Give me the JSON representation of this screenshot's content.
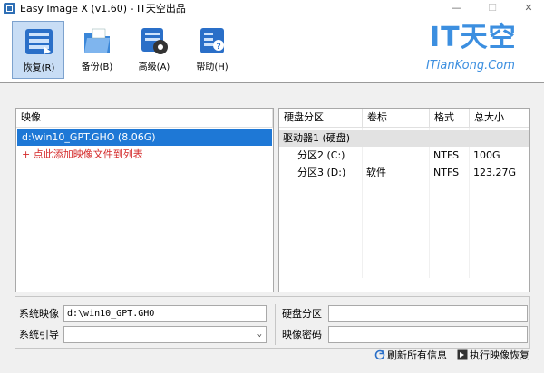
{
  "window": {
    "title": "Easy Image X (v1.60) - IT天空出品",
    "min_glyph": "—",
    "max_glyph": "☐",
    "close_glyph": "✕"
  },
  "toolbar": {
    "buttons": [
      {
        "label": "恢复(R)",
        "icon": "restore-icon",
        "active": true
      },
      {
        "label": "备份(B)",
        "icon": "backup-icon",
        "active": false
      },
      {
        "label": "高级(A)",
        "icon": "advanced-icon",
        "active": false
      },
      {
        "label": "帮助(H)",
        "icon": "help-icon",
        "active": false
      }
    ]
  },
  "brand": {
    "main": "IT天空",
    "sub": "ITianKong.Com",
    "color": "#3c8fe0"
  },
  "image_list": {
    "header": "映像",
    "items": [
      "d:\\win10_GPT.GHO (8.06G)"
    ],
    "add_hint": "+ 点此添加映像文件到列表"
  },
  "disk_table": {
    "columns": [
      "硬盘分区",
      "卷标",
      "格式",
      "总大小"
    ],
    "drive": "驱动器1 (硬盘)",
    "partitions": [
      {
        "name": "分区2 (C:)",
        "label": "",
        "format": "NTFS",
        "size": "100G"
      },
      {
        "name": "分区3 (D:)",
        "label": "软件",
        "format": "NTFS",
        "size": "123.27G"
      }
    ]
  },
  "form": {
    "system_image_label": "系统映像",
    "system_image_value": "d:\\win10_GPT.GHO",
    "system_boot_label": "系统引导",
    "system_boot_value": "",
    "disk_partition_label": "硬盘分区",
    "disk_partition_value": "",
    "image_password_label": "映像密码",
    "image_password_value": ""
  },
  "actions": {
    "refresh": "刷新所有信息",
    "execute": "执行映像恢复"
  },
  "colors": {
    "selection": "#1e78d6",
    "add_hint": "#d42a2a",
    "toolbar_active": "#c8ddf5"
  }
}
